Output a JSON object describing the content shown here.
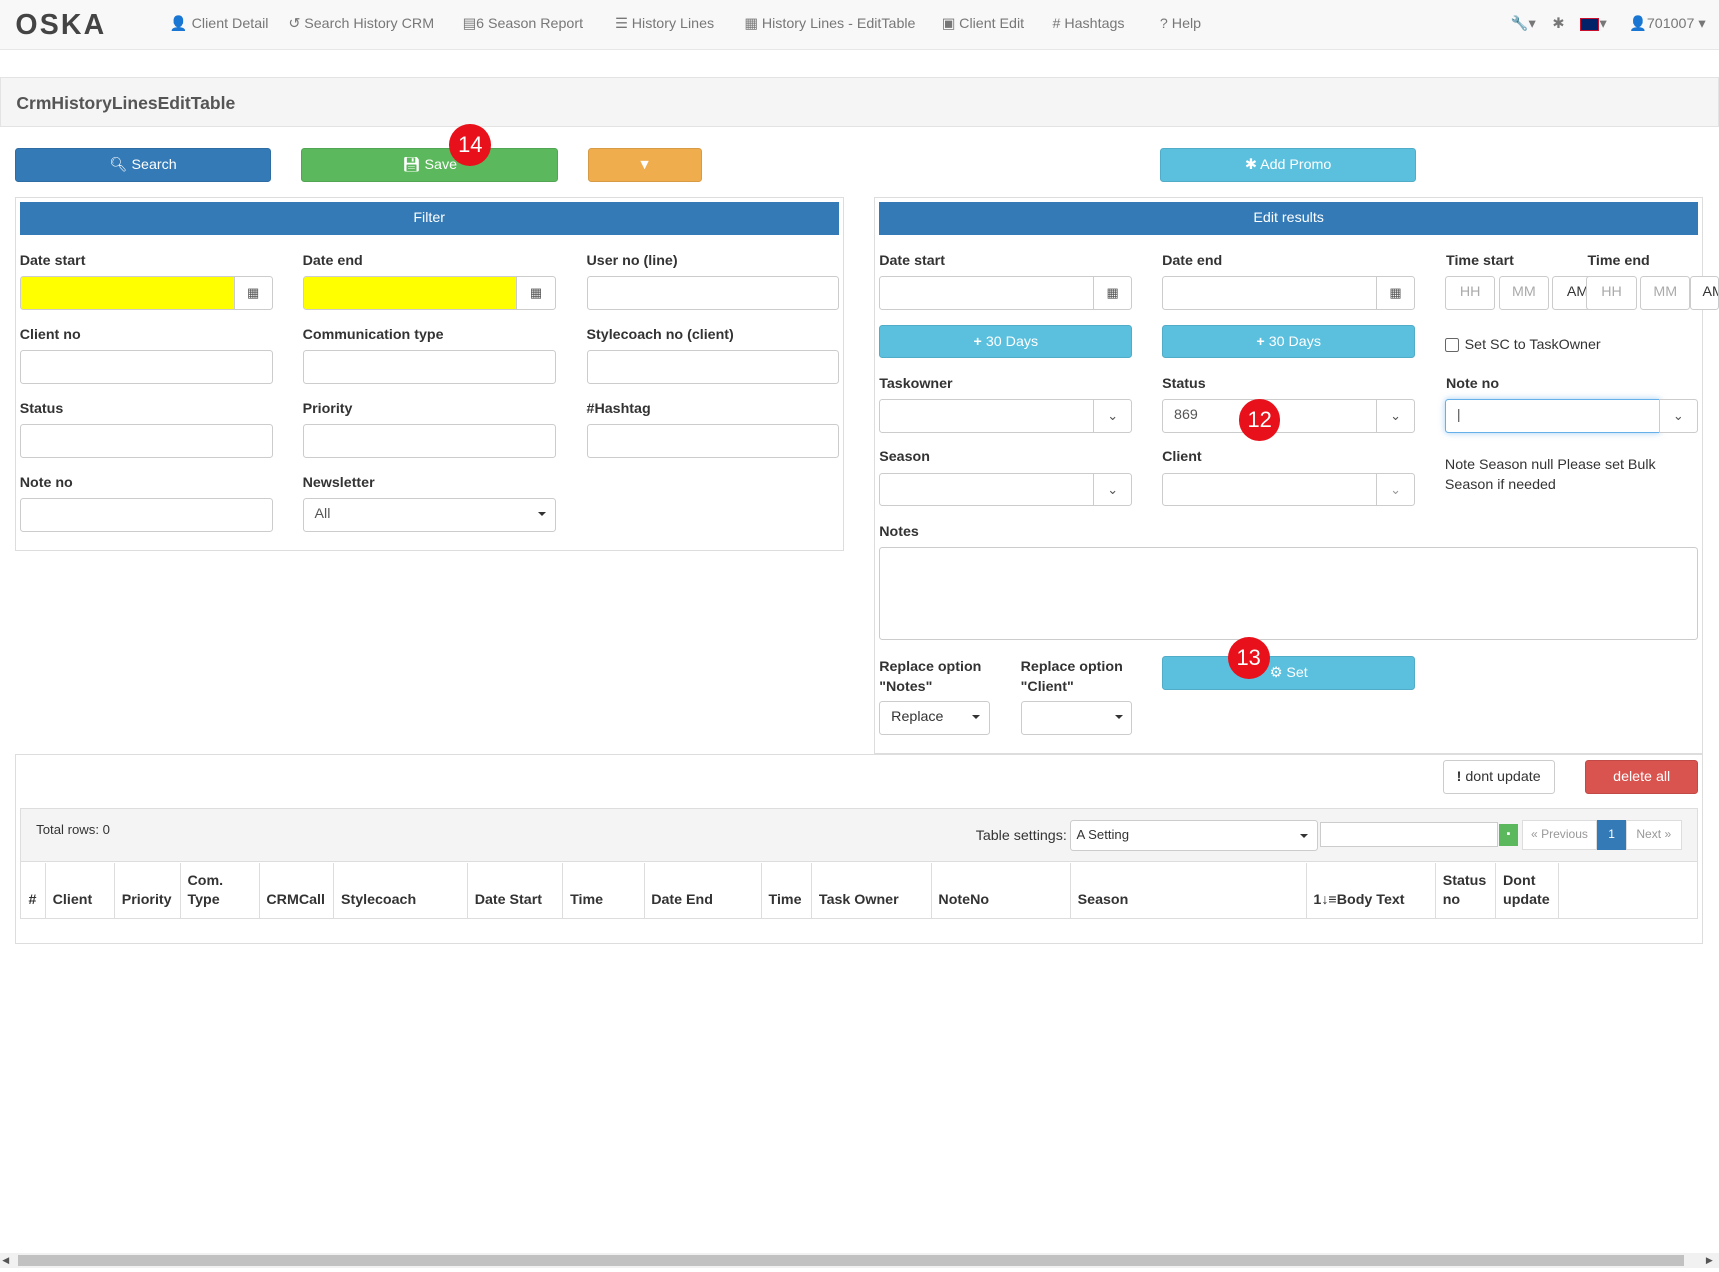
{
  "nav": {
    "logo": "OSKA",
    "items": [
      {
        "icon": "user-icon",
        "glyph": "👤",
        "label": "Client Detail"
      },
      {
        "icon": "history-icon",
        "glyph": "↺",
        "label": "Search History CRM"
      },
      {
        "icon": "report-icon",
        "glyph": "▤",
        "label": "6 Season Report"
      },
      {
        "icon": "list-icon",
        "glyph": "☰",
        "label": "History Lines"
      },
      {
        "icon": "table-icon",
        "glyph": "▦",
        "label": "History Lines - EditTable"
      },
      {
        "icon": "id-card-icon",
        "glyph": "▣",
        "label": "Client Edit"
      },
      {
        "icon": "hashtag-icon",
        "glyph": "#",
        "label": "Hashtags"
      },
      {
        "icon": "question-icon",
        "glyph": "?",
        "label": "Help"
      }
    ],
    "user": "701007"
  },
  "page_title": "CrmHistoryLinesEditTable",
  "toolbar": {
    "search": "Search",
    "save": "Save",
    "add_promo": "Add Promo"
  },
  "badges": {
    "save": "14",
    "status": "12",
    "set": "13"
  },
  "filter": {
    "title": "Filter",
    "date_start": "Date start",
    "date_end": "Date end",
    "user_no": "User no (line)",
    "client_no": "Client no",
    "communication_type": "Communication type",
    "stylecoach_no": "Stylecoach no (client)",
    "status": "Status",
    "priority": "Priority",
    "hashtag": "#Hashtag",
    "note_no": "Note no",
    "newsletter": "Newsletter",
    "newsletter_value": "All"
  },
  "edit": {
    "title": "Edit results",
    "date_start": "Date start",
    "date_end": "Date end",
    "time_start": "Time start",
    "time_end": "Time end",
    "hh": "HH",
    "mm": "MM",
    "am": "AM",
    "plus30": "30 Days",
    "set_sc": "Set SC to TaskOwner",
    "taskowner": "Taskowner",
    "status": "Status",
    "status_value": "869",
    "note_no": "Note no",
    "season": "Season",
    "client": "Client",
    "note_msg": "Note Season null Please set Bulk Season if needed",
    "notes": "Notes",
    "replace_notes": "Replace option \"Notes\"",
    "replace_client": "Replace option \"Client\"",
    "replace_value": "Replace",
    "set": "Set"
  },
  "table": {
    "dont_update": "dont update",
    "delete_all": "delete all",
    "total_rows": "Total rows: 0",
    "settings_label": "Table settings:",
    "settings_value": "A Setting",
    "prev": "« Previous",
    "page": "1",
    "next": "Next »",
    "columns": [
      "#",
      "Client",
      "Priority",
      "Com. Type",
      "CRMCall",
      "Stylecoach",
      "Date Start",
      "Time",
      "Date End",
      "Time",
      "Task Owner",
      "NoteNo",
      "Season",
      "1↓≡Body Text",
      "Status no",
      "Dont update"
    ]
  }
}
